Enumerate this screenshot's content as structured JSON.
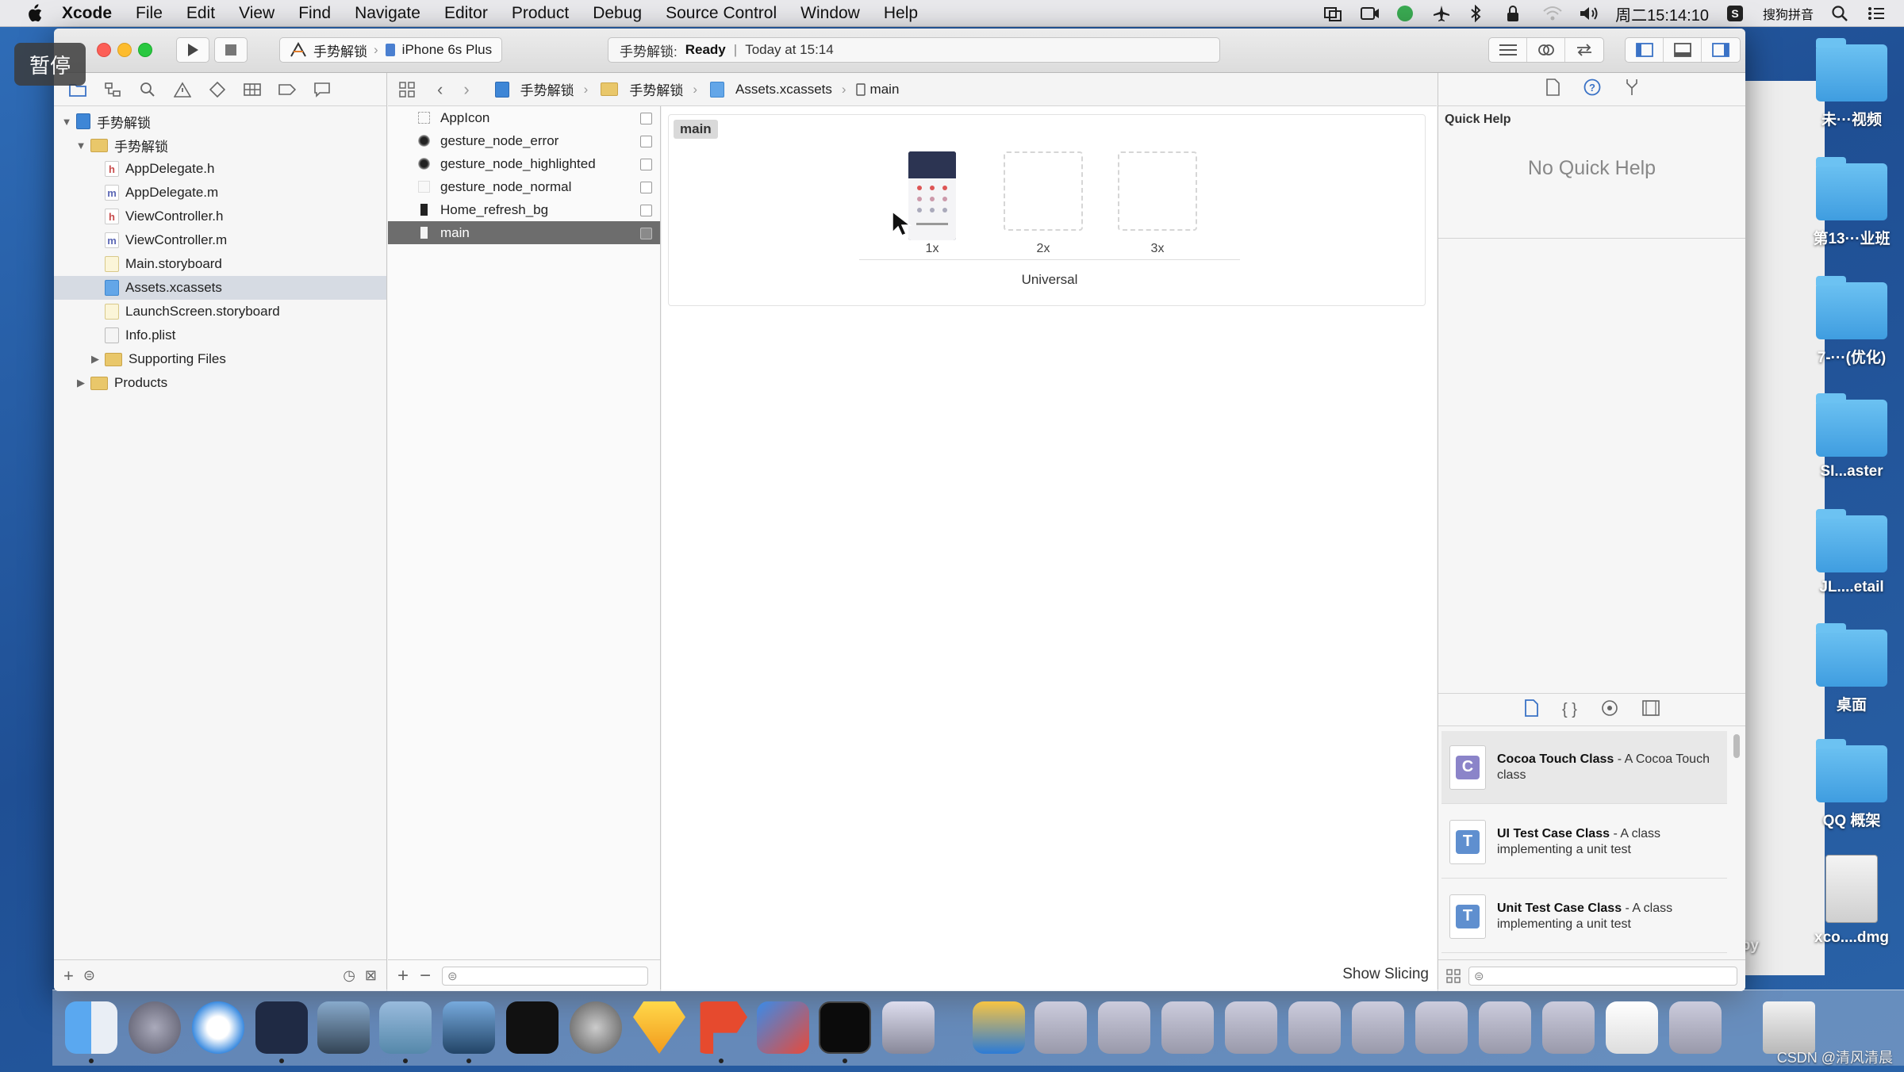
{
  "menubar": {
    "app": "Xcode",
    "items": [
      "File",
      "Edit",
      "View",
      "Find",
      "Navigate",
      "Editor",
      "Product",
      "Debug",
      "Source Control",
      "Window",
      "Help"
    ],
    "clock": "周二15:14:10",
    "input_method": "搜狗拼音"
  },
  "overlay": {
    "pause_label": "暂停"
  },
  "toolbar": {
    "scheme_name": "手势解锁",
    "device": "iPhone 6s Plus",
    "status_project": "手势解锁:",
    "status_state": "Ready",
    "status_divider": "|",
    "status_time": "Today at 15:14"
  },
  "jumpbar": {
    "crumbs": [
      "手势解锁",
      "手势解锁",
      "Assets.xcassets",
      "main"
    ]
  },
  "navigator": {
    "tree": [
      {
        "label": "手势解锁",
        "icon": "project-icon",
        "disclosure": "▼"
      },
      {
        "label": "手势解锁",
        "icon": "folder-icon",
        "disclosure": "▼"
      },
      {
        "label": "AppDelegate.h",
        "icon": "h",
        "disclosure": ""
      },
      {
        "label": "AppDelegate.m",
        "icon": "m",
        "disclosure": ""
      },
      {
        "label": "ViewController.h",
        "icon": "h",
        "disclosure": ""
      },
      {
        "label": "ViewController.m",
        "icon": "m",
        "disclosure": ""
      },
      {
        "label": "Main.storyboard",
        "icon": "storyboard",
        "disclosure": ""
      },
      {
        "label": "Assets.xcassets",
        "icon": "xcassets",
        "disclosure": ""
      },
      {
        "label": "LaunchScreen.storyboard",
        "icon": "storyboard",
        "disclosure": ""
      },
      {
        "label": "Info.plist",
        "icon": "plist",
        "disclosure": ""
      },
      {
        "label": "Supporting Files",
        "icon": "folder-icon",
        "disclosure": "▶"
      },
      {
        "label": "Products",
        "icon": "folder-icon",
        "disclosure": "▶"
      }
    ],
    "selected_index": 7
  },
  "assets": {
    "items": [
      "AppIcon",
      "gesture_node_error",
      "gesture_node_highlighted",
      "gesture_node_normal",
      "Home_refresh_bg",
      "main"
    ],
    "selected_index": 5
  },
  "editor": {
    "set_name": "main",
    "slots": [
      "1x",
      "2x",
      "3x"
    ],
    "device_group": "Universal",
    "show_slicing": "Show Slicing"
  },
  "inspector": {
    "quick_help_title": "Quick Help",
    "quick_help_empty": "No Quick Help",
    "library": [
      {
        "letter": "C",
        "title": "Cocoa Touch Class",
        "desc": " - A Cocoa Touch class",
        "color": "#8b84c9"
      },
      {
        "letter": "T",
        "title": "UI Test Case Class",
        "desc": " - A class implementing a unit test",
        "color": "#5f8fcf"
      },
      {
        "letter": "T",
        "title": "Unit Test Case Class",
        "desc": " - A class implementing a unit test",
        "color": "#5f8fcf"
      }
    ]
  },
  "desktop": {
    "items": [
      "未···视频",
      "第13···业班",
      "7-···(优化)",
      "SI...aster",
      "JL....etail",
      "桌面",
      "QQ 概架",
      "xco....dmg"
    ],
    "partial_label": "opy"
  },
  "watermark": "CSDN @清风清晨",
  "colors": {
    "selection": "#6d6d6d",
    "accent": "#3e86d6"
  }
}
